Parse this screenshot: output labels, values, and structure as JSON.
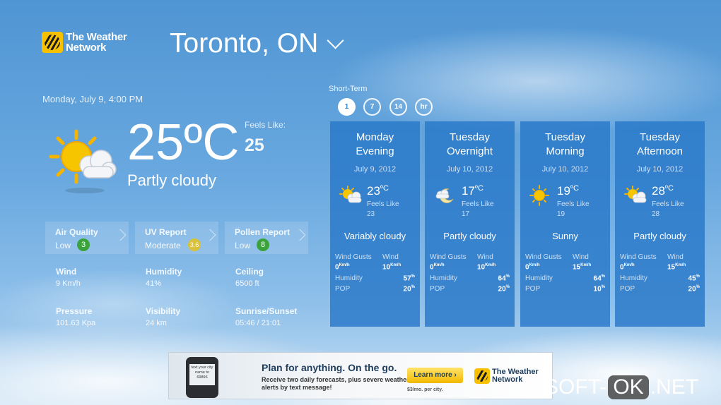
{
  "app": {
    "brand": "The Weather Network",
    "brand_line1": "The Weather",
    "brand_line2": "Network",
    "accent_color": "#2878c8",
    "logo_color": "#f7c100"
  },
  "header": {
    "city": "Toronto, ON",
    "city_dropdown_icon": "chevron-down-icon"
  },
  "current": {
    "datetime": "Monday, July 9, 4:00 PM",
    "temperature": "25",
    "unit": "ºC",
    "feels_like_label": "Feels Like:",
    "feels_like_value": "25",
    "condition": "Partly cloudy",
    "icon": "partly-cloudy-icon"
  },
  "tiles": [
    {
      "title": "Air Quality",
      "value": "Low",
      "badge": "3",
      "badge_color": "#3aa33a"
    },
    {
      "title": "UV Report",
      "value": "Moderate",
      "badge": "3.6",
      "badge_color": "#d9c23a"
    },
    {
      "title": "Pollen Report",
      "value": "Low",
      "badge": "8",
      "badge_color": "#3aa33a"
    }
  ],
  "stats": {
    "wind_label": "Wind",
    "wind_value": "9 Km/h",
    "humidity_label": "Humidity",
    "humidity_value": "41%",
    "ceiling_label": "Ceiling",
    "ceiling_value": "6500 ft",
    "pressure_label": "Pressure",
    "pressure_value": "101.63 Kpa",
    "visibility_label": "Visibility",
    "visibility_value": "24 km",
    "sun_label": "Sunrise/Sunset",
    "sun_value": "05:46 / 21:01"
  },
  "short_term": {
    "label": "Short-Term",
    "pills": [
      "1",
      "7",
      "14",
      "hr"
    ],
    "active": "1"
  },
  "forecast": [
    {
      "period_line1": "Monday",
      "period_line2": "Evening",
      "date": "July 9, 2012",
      "temp": "23",
      "unit": "ºC",
      "feels_like_label": "Feels Like",
      "feels_like": "23",
      "condition": "Variably cloudy",
      "icon": "partly-cloudy-icon",
      "wind_gusts_label": "Wind Gusts",
      "wind_label": "Wind",
      "wind_gusts": "0",
      "wind": "10",
      "speed_unit": "Km/h",
      "humidity_label": "Humidity",
      "humidity": "57",
      "pop_label": "POP",
      "pop": "20",
      "pct": "%"
    },
    {
      "period_line1": "Tuesday",
      "period_line2": "Overnight",
      "date": "July 10, 2012",
      "temp": "17",
      "unit": "ºC",
      "feels_like_label": "Feels Like",
      "feels_like": "17",
      "condition": "Partly cloudy",
      "icon": "cloudy-night-icon",
      "wind_gusts_label": "Wind Gusts",
      "wind_label": "Wind",
      "wind_gusts": "0",
      "wind": "10",
      "speed_unit": "Km/h",
      "humidity_label": "Humidity",
      "humidity": "64",
      "pop_label": "POP",
      "pop": "20",
      "pct": "%"
    },
    {
      "period_line1": "Tuesday",
      "period_line2": "Morning",
      "date": "July 10, 2012",
      "temp": "19",
      "unit": "ºC",
      "feels_like_label": "Feels Like",
      "feels_like": "19",
      "condition": "Sunny",
      "icon": "sun-icon",
      "wind_gusts_label": "Wind Gusts",
      "wind_label": "Wind",
      "wind_gusts": "0",
      "wind": "15",
      "speed_unit": "Km/h",
      "humidity_label": "Humidity",
      "humidity": "64",
      "pop_label": "POP",
      "pop": "10",
      "pct": "%"
    },
    {
      "period_line1": "Tuesday",
      "period_line2": "Afternoon",
      "date": "July 10, 2012",
      "temp": "28",
      "unit": "ºC",
      "feels_like_label": "Feels Like",
      "feels_like": "28",
      "condition": "Partly cloudy",
      "icon": "partly-cloudy-icon",
      "wind_gusts_label": "Wind Gusts",
      "wind_label": "Wind",
      "wind_gusts": "0",
      "wind": "15",
      "speed_unit": "Km/h",
      "humidity_label": "Humidity",
      "humidity": "45",
      "pop_label": "POP",
      "pop": "20",
      "pct": "%"
    }
  ],
  "ad": {
    "headline": "Plan for anything. On the go.",
    "sub": "Receive two daily forecasts, plus severe weather alerts by text message!",
    "button": "Learn more ›",
    "price": "$3/mo. per city.",
    "phone_text": "text your city name to 69896",
    "brand_line1": "The Weather",
    "brand_line2": "Network"
  },
  "watermark": {
    "part1": "SOFT-",
    "part2": "OK",
    "part3": ".NET"
  }
}
